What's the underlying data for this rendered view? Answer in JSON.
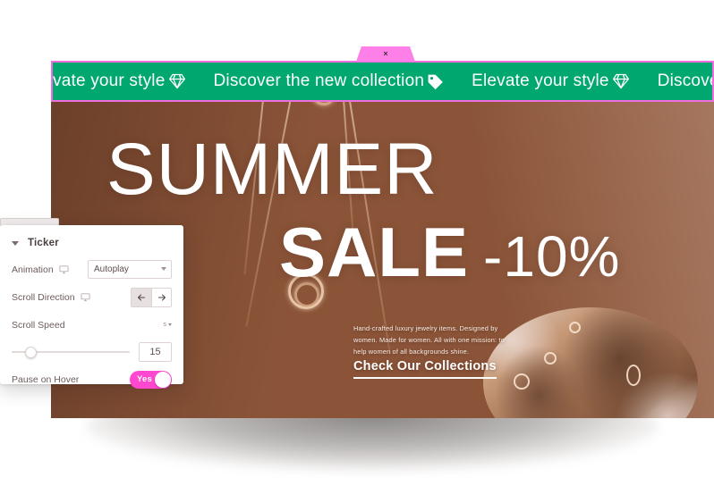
{
  "banner": {
    "headline": "SUMMER",
    "sale_word": "SALE",
    "discount": "-10%",
    "description": "Hand-crafted luxury jewelry items. Designed by women. Made for women. All with one mission: to help women of all backgrounds shine.",
    "cta_label": "Check Our Collections"
  },
  "ticker": {
    "close_label": "×",
    "border_color": "#f06de0",
    "background_color": "#00a870",
    "text_color": "#ffffff",
    "items": [
      {
        "text": "vate your style",
        "icon": "diamond-icon"
      },
      {
        "text": "Discover the new collection",
        "icon": "tag-icon"
      },
      {
        "text": "Elevate your style",
        "icon": "diamond-icon"
      },
      {
        "text": "Discover the new co",
        "icon": "tag-icon"
      }
    ]
  },
  "panel": {
    "title": "Ticker",
    "collapse_icon": "caret-down-icon",
    "rows": {
      "animation": {
        "label": "Animation",
        "device_icon": "desktop-icon",
        "value": "Autoplay",
        "options": [
          "Autoplay"
        ]
      },
      "scroll_direction": {
        "label": "Scroll Direction",
        "device_icon": "desktop-icon",
        "left_icon": "arrow-left-icon",
        "right_icon": "arrow-right-icon",
        "selected": "left"
      },
      "scroll_speed": {
        "label": "Scroll Speed",
        "unit": "s",
        "unit_caret": "caret-down-icon",
        "value": "15",
        "slider_percent": 11
      },
      "pause_on_hover": {
        "label": "Pause on Hover",
        "toggle_value": "Yes",
        "toggle_color": "#ff47d0"
      }
    }
  }
}
